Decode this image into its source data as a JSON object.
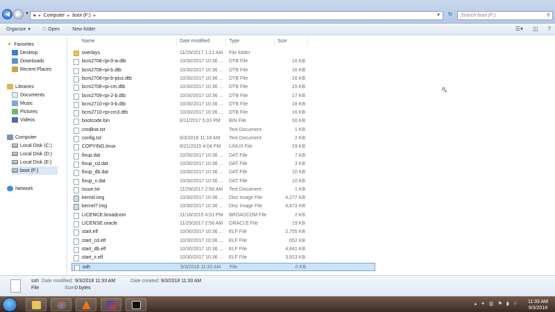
{
  "address_bar": {
    "breadcrumbs": [
      "Computer",
      "boot (F:)"
    ],
    "search_placeholder": "Search boot (F:)"
  },
  "toolbar": {
    "organize_label": "Organize",
    "open_label": "Open",
    "new_folder_label": "New folder"
  },
  "nav": {
    "favorites_label": "Favorites",
    "favorites": [
      "Desktop",
      "Downloads",
      "Recent Places"
    ],
    "libraries_label": "Libraries",
    "libraries": [
      "Documents",
      "Music",
      "Pictures",
      "Videos"
    ],
    "computer_label": "Computer",
    "drives": [
      "Local Disk (C:)",
      "Local Disk (D:)",
      "Local Disk (E:)",
      "boot (F:)"
    ],
    "network_label": "Network",
    "selected": "boot (F:)"
  },
  "columns": {
    "name": "Name",
    "date_modified": "Date modified",
    "type": "Type",
    "size": "Size"
  },
  "files": [
    {
      "name": "overlays",
      "date": "11/29/2017 1:21 AM",
      "type": "File folder",
      "size": "",
      "icon": "folder-icon"
    },
    {
      "name": "bcm2708-rpi-0-w.dtb",
      "date": "10/30/2017 10:36 ...",
      "type": "DTB File",
      "size": "16 KB",
      "icon": "file-icon"
    },
    {
      "name": "bcm2708-rpi-b.dtb",
      "date": "10/30/2017 10:36 ...",
      "type": "DTB File",
      "size": "16 KB",
      "icon": "file-icon"
    },
    {
      "name": "bcm2708-rpi-b-plus.dtb",
      "date": "10/30/2017 10:36 ...",
      "type": "DTB File",
      "size": "16 KB",
      "icon": "file-icon"
    },
    {
      "name": "bcm2708-rpi-cm.dtb",
      "date": "10/30/2017 10:36 ...",
      "type": "DTB File",
      "size": "15 KB",
      "icon": "file-icon"
    },
    {
      "name": "bcm2709-rpi-2-b.dtb",
      "date": "10/30/2017 10:36 ...",
      "type": "DTB File",
      "size": "17 KB",
      "icon": "file-icon"
    },
    {
      "name": "bcm2710-rpi-3-b.dtb",
      "date": "10/30/2017 10:36 ...",
      "type": "DTB File",
      "size": "18 KB",
      "icon": "file-icon"
    },
    {
      "name": "bcm2710-rpi-cm3.dtb",
      "date": "10/30/2017 10:36 ...",
      "type": "DTB File",
      "size": "16 KB",
      "icon": "file-icon"
    },
    {
      "name": "bootcode.bin",
      "date": "8/11/2017 5:03 PM",
      "type": "BIN File",
      "size": "50 KB",
      "icon": "file-icon"
    },
    {
      "name": "cmdline.txt",
      "date": "",
      "type": "Text Document",
      "size": "1 KB",
      "icon": "text-file-icon"
    },
    {
      "name": "config.txt",
      "date": "9/3/2018 11:18 AM",
      "type": "Text Document",
      "size": "2 KB",
      "icon": "text-file-icon"
    },
    {
      "name": "COPYING.linux",
      "date": "8/21/2015 4:04 PM",
      "type": "LINUX File",
      "size": "19 KB",
      "icon": "file-icon"
    },
    {
      "name": "fixup.dat",
      "date": "10/30/2017 10:36 ...",
      "type": "DAT File",
      "size": "7 KB",
      "icon": "file-icon"
    },
    {
      "name": "fixup_cd.dat",
      "date": "10/30/2017 10:36 ...",
      "type": "DAT File",
      "size": "3 KB",
      "icon": "file-icon"
    },
    {
      "name": "fixup_db.dat",
      "date": "10/30/2017 10:36 ...",
      "type": "DAT File",
      "size": "10 KB",
      "icon": "file-icon"
    },
    {
      "name": "fixup_x.dat",
      "date": "10/30/2017 10:36 ...",
      "type": "DAT File",
      "size": "10 KB",
      "icon": "file-icon"
    },
    {
      "name": "issue.txt",
      "date": "11/29/2017 2:56 AM",
      "type": "Text Document",
      "size": "1 KB",
      "icon": "text-file-icon"
    },
    {
      "name": "kernel.img",
      "date": "10/30/2017 10:36 ...",
      "type": "Disc Image File",
      "size": "4,277 KB",
      "icon": "disc-image-icon"
    },
    {
      "name": "kernel7.img",
      "date": "10/30/2017 10:36 ...",
      "type": "Disc Image File",
      "size": "4,473 KB",
      "icon": "disc-image-icon"
    },
    {
      "name": "LICENCE.broadcom",
      "date": "11/18/2015 4:01 PM",
      "type": "BROADCOM File",
      "size": "2 KB",
      "icon": "file-icon"
    },
    {
      "name": "LICENSE.oracle",
      "date": "11/29/2017 2:56 AM",
      "type": "ORACLE File",
      "size": "19 KB",
      "icon": "file-icon"
    },
    {
      "name": "start.elf",
      "date": "10/30/2017 10:36 ...",
      "type": "ELF File",
      "size": "2,755 KB",
      "icon": "file-icon"
    },
    {
      "name": "start_cd.elf",
      "date": "10/30/2017 10:36 ...",
      "type": "ELF File",
      "size": "652 KB",
      "icon": "file-icon"
    },
    {
      "name": "start_db.elf",
      "date": "10/30/2017 10:36 ...",
      "type": "ELF File",
      "size": "4,841 KB",
      "icon": "file-icon"
    },
    {
      "name": "start_x.elf",
      "date": "10/30/2017 10:36 ...",
      "type": "ELF File",
      "size": "3,813 KB",
      "icon": "file-icon"
    },
    {
      "name": "ssh",
      "date": "9/3/2018 11:33 AM",
      "type": "File",
      "size": "0 KB",
      "icon": "file-icon"
    }
  ],
  "selected_file": "ssh",
  "details": {
    "name": "ssh",
    "type": "File",
    "date_modified_label": "Date modified:",
    "date_modified": "9/3/2018 11:33 AM",
    "date_created_label": "Date created:",
    "date_created": "9/3/2018 11:33 AM",
    "size_label": "Size:",
    "size": "0 bytes"
  },
  "taskbar": {
    "apps": [
      "file-explorer-icon",
      "chrome-icon",
      "vlc-icon",
      "media-player-icon",
      "recorder-icon"
    ],
    "time": "11:33 AM",
    "date": "9/3/2018"
  }
}
